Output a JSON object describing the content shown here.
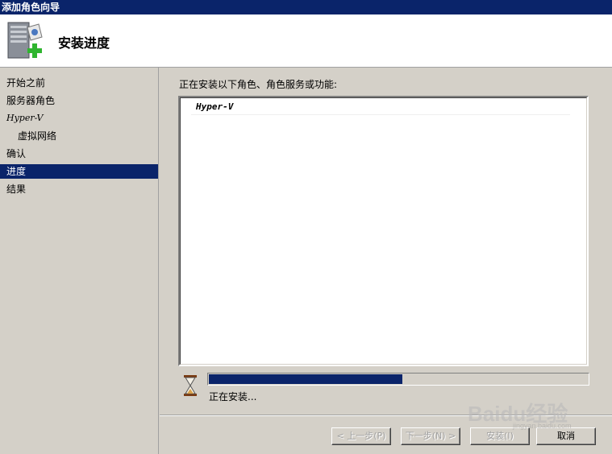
{
  "window": {
    "title": "添加角色向导"
  },
  "header": {
    "title": "安装进度"
  },
  "sidebar": {
    "items": [
      {
        "label": "开始之前"
      },
      {
        "label": "服务器角色"
      },
      {
        "label": "Hyper-V"
      },
      {
        "label": "虚拟网络"
      },
      {
        "label": "确认"
      },
      {
        "label": "进度",
        "active": true
      },
      {
        "label": "结果"
      }
    ]
  },
  "main": {
    "label": "正在安装以下角色、角色服务或功能:",
    "list": [
      {
        "label": "Hyper-V"
      }
    ],
    "progress": {
      "fraction": 0.51
    },
    "status": "正在安装..."
  },
  "buttons": {
    "prev": "< 上一步(P)",
    "next": "下一步(N) >",
    "install": "安装(I)",
    "cancel": "取消"
  },
  "watermark": {
    "text": "Baidu经验",
    "sub": "jingyan.baidu.com"
  },
  "colors": {
    "accent": "#0a246a",
    "face": "#d4d0c8"
  }
}
